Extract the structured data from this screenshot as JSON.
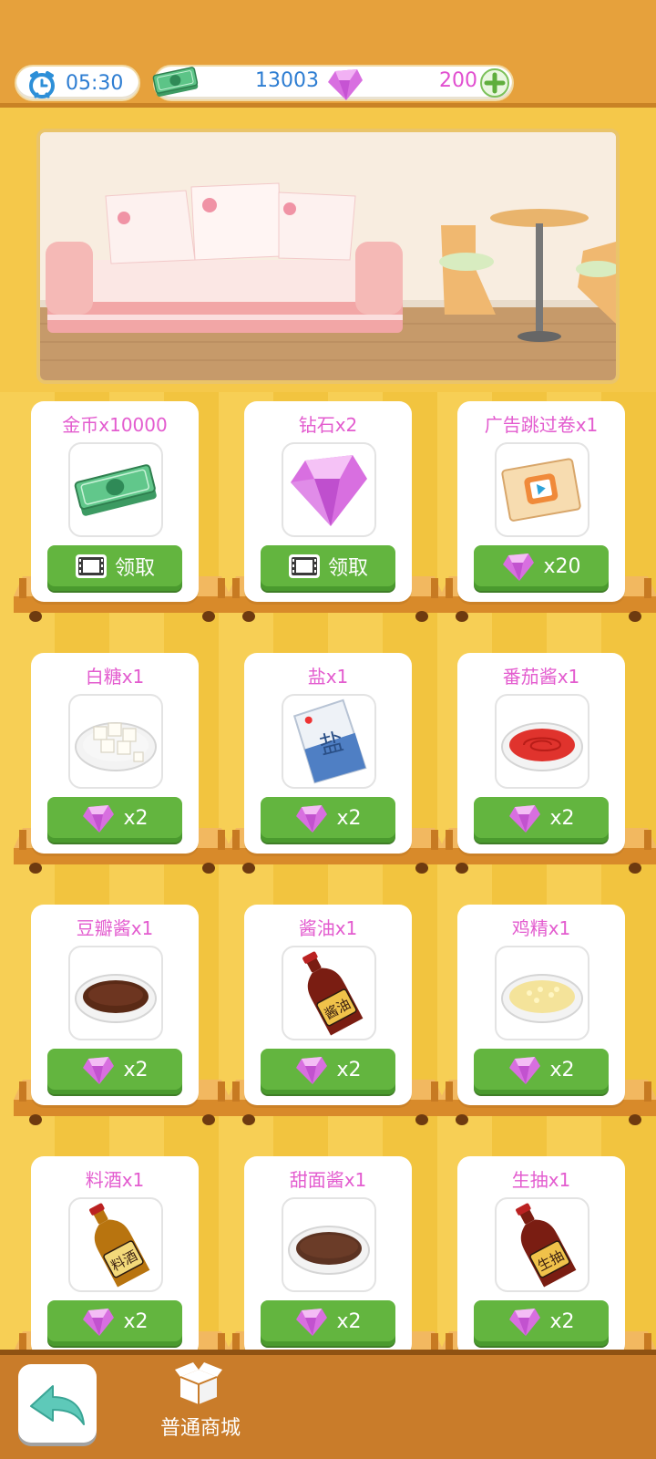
{
  "header": {
    "time": "05:30",
    "coins": "13003",
    "gems": "200",
    "clock_icon": "alarm-clock-icon",
    "cash_icon": "cash-stack-icon",
    "gem_icon": "pink-diamond-icon",
    "plus_icon": "plus-icon"
  },
  "banner": {
    "scene": "living-room-sofa"
  },
  "shop": {
    "items": [
      {
        "title": "金币x10000",
        "icon": "cash-stack-icon",
        "price_type": "video",
        "price": "领取"
      },
      {
        "title": "钻石x2",
        "icon": "pink-diamond-icon",
        "price_type": "video",
        "price": "领取"
      },
      {
        "title": "广告跳过卷x1",
        "icon": "ad-skip-ticket-icon",
        "price_type": "gem",
        "price": "x20"
      },
      {
        "title": "白糖x1",
        "icon": "sugar-cubes-icon",
        "price_type": "gem",
        "price": "x2"
      },
      {
        "title": "盐x1",
        "icon": "salt-bag-icon",
        "price_type": "gem",
        "price": "x2"
      },
      {
        "title": "番茄酱x1",
        "icon": "ketchup-plate-icon",
        "price_type": "gem",
        "price": "x2"
      },
      {
        "title": "豆瓣酱x1",
        "icon": "bean-paste-plate-icon",
        "price_type": "gem",
        "price": "x2"
      },
      {
        "title": "酱油x1",
        "icon": "soy-sauce-bottle-icon",
        "price_type": "gem",
        "price": "x2"
      },
      {
        "title": "鸡精x1",
        "icon": "chicken-essence-plate-icon",
        "price_type": "gem",
        "price": "x2"
      },
      {
        "title": "料酒x1",
        "icon": "cooking-wine-bottle-icon",
        "price_type": "gem",
        "price": "x2"
      },
      {
        "title": "甜面酱x1",
        "icon": "sweet-bean-sauce-plate-icon",
        "price_type": "gem",
        "price": "x2"
      },
      {
        "title": "生抽x1",
        "icon": "light-soy-bottle-icon",
        "price_type": "gem",
        "price": "x2"
      }
    ],
    "bottle_labels": {
      "soy": "酱油",
      "wine": "料酒",
      "light": "生抽",
      "salt": "盐"
    }
  },
  "footer": {
    "back_icon": "back-arrow-icon",
    "store_icon": "box-icon",
    "store_label": "普通商城"
  },
  "colors": {
    "gem": "#e14fd0",
    "coin_text": "#2d7dd2",
    "button_green": "#63b53f",
    "header_bg": "#e6a13c",
    "footer_bg": "#c97c2a"
  }
}
